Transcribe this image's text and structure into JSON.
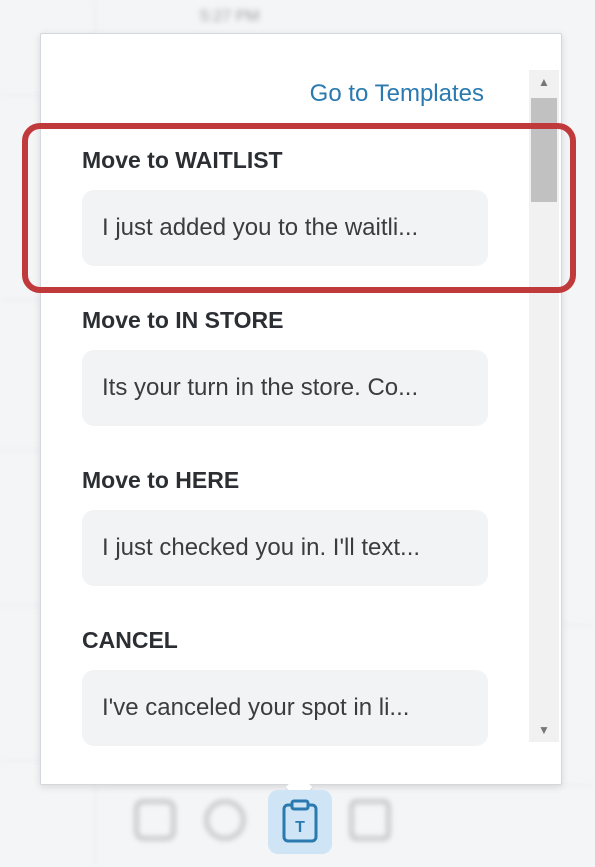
{
  "background": {
    "time": "5:27 PM"
  },
  "popover": {
    "go_to_templates": "Go to Templates",
    "templates": [
      {
        "title": "Move to WAITLIST",
        "preview": "I just added you to the waitli..."
      },
      {
        "title": "Move to IN STORE",
        "preview": "Its your turn in the store. Co..."
      },
      {
        "title": "Move to HERE",
        "preview": "I just checked you in. I'll text..."
      },
      {
        "title": "CANCEL",
        "preview": "I've canceled your spot in li..."
      }
    ]
  },
  "colors": {
    "link": "#2a7ab0",
    "highlight": "#c0393b",
    "trigger_bg": "#cfe5f5",
    "icon": "#2a7ab0"
  },
  "icons": {
    "trigger": "template-clipboard-icon",
    "scroll_up": "triangle-up-icon",
    "scroll_down": "triangle-down-icon"
  }
}
